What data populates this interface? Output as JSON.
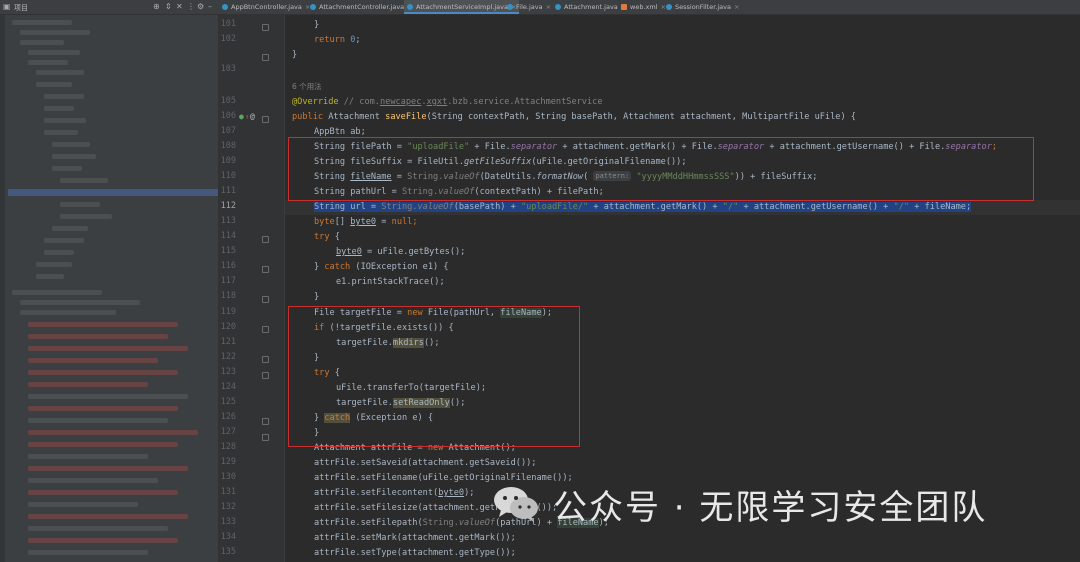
{
  "project_panel": {
    "title": "项目"
  },
  "tabs": [
    {
      "label": "AppBtnController.java",
      "active": false
    },
    {
      "label": "AttachmentController.java",
      "active": false
    },
    {
      "label": "AttachmentServiceImpl.java",
      "active": true
    },
    {
      "label": "File.java",
      "active": false
    },
    {
      "label": "Attachment.java",
      "active": false
    },
    {
      "label": "web.xml",
      "active": false
    },
    {
      "label": "SessionFilter.java",
      "active": false
    }
  ],
  "editor": {
    "usages_hint": "6 个用法",
    "current_line": "112",
    "line_numbers": [
      "101",
      "102",
      "103",
      "105",
      "106",
      "107",
      "108",
      "109",
      "110",
      "111",
      "112",
      "113",
      "114",
      "115",
      "116",
      "117",
      "118",
      "119",
      "120",
      "121",
      "122",
      "123",
      "124",
      "125",
      "126",
      "127",
      "128",
      "129",
      "130",
      "131",
      "132",
      "133",
      "134",
      "135"
    ],
    "code": {
      "l101": "}",
      "l102a": "return ",
      "l102b": "0",
      "l102c": ";",
      "l103": "}",
      "l105a": "@Override",
      "l105b": " // com.",
      "l105c": "newcapec",
      "l105d": ".",
      "l105e": "xgxt",
      "l105f": ".bzb.service.AttachmentService",
      "l106a": "public ",
      "l106b": "Attachment ",
      "l106c": "saveFile",
      "l106d": "(String contextPath, String basePath, Attachment attachment, MultipartFile uFile) {",
      "l107": "AppBtn ab;",
      "l108a": "String ",
      "l108b": "filePath",
      "l108c": " = ",
      "l108d": "\"uploadFile\"",
      "l108e": " + File.",
      "l108f": "separator",
      "l108g": " + attachment.getMark() + File.",
      "l108h": "separator",
      "l108i": " + attachment.getUsername() + File.",
      "l108j": "separator",
      "l108k": ";",
      "l109a": "String fileSuffix = FileUtil.",
      "l109b": "getFileSuffix",
      "l109c": "(uFile.getOriginalFilename());",
      "l110a": "String ",
      "l110b": "fileName",
      "l110c": " = ",
      "l110d": "String.",
      "l110e": "valueOf",
      "l110f": "(DateUtils.",
      "l110g": "formatNow",
      "l110h": "( ",
      "l110i": "pattern:",
      "l110j": " \"yyyyMMddHHmmssSSS\"",
      "l110k": ")) + fileSuffix;",
      "l111a": "String pathUrl = ",
      "l111b": "String.",
      "l111c": "valueOf",
      "l111d": "(contextPath) + filePath;",
      "l112a": "String url = ",
      "l112b": "String.",
      "l112c": "valueOf",
      "l112d": "(basePath) + ",
      "l112e": "\"uploadFile/\"",
      "l112f": " + attachment.getMark() + ",
      "l112g": "\"/\"",
      "l112h": " + attachment.getUsername() + ",
      "l112i": "\"/\"",
      "l112j": " + fileName;",
      "l113a": "byte",
      "l113b": "[] ",
      "l113c": "byte0",
      "l113d": " = ",
      "l113e": "null",
      "l113f": ";",
      "l114a": "try",
      "l114b": " {",
      "l115a": "byte0",
      "l115b": " = uFile.getBytes();",
      "l116a": "} ",
      "l116b": "catch",
      "l116c": " (IOException e1) {",
      "l117": "e1.printStackTrace();",
      "l118": "}",
      "l119a": "File targetFile = ",
      "l119b": "new ",
      "l119c": "File(pathUrl, ",
      "l119d": "fileName",
      "l119e": ");",
      "l120a": "if",
      "l120b": " (!targetFile.exists()) {",
      "l121a": "targetFile.",
      "l121b": "mkdirs",
      "l121c": "();",
      "l122": "}",
      "l123a": "try",
      "l123b": " {",
      "l124": "uFile.transferTo(targetFile);",
      "l125a": "targetFile.",
      "l125b": "setReadOnly",
      "l125c": "();",
      "l126a": "} ",
      "l126b": "catch",
      "l126c": " (Exception e) {",
      "l127": "}",
      "l128a": "Attachment attrFile = ",
      "l128b": "new ",
      "l128c": "Attachment();",
      "l129": "attrFile.setSaveid(attachment.getSaveid());",
      "l130": "attrFile.setFilename(uFile.getOriginalFilename());",
      "l131a": "attrFile.setFilecontent(",
      "l131b": "byte0",
      "l131c": ");",
      "l132": "attrFile.setFilesize(attachment.getFilesize());",
      "l133a": "attrFile.setFilepath(",
      "l133b": "String.",
      "l133c": "valueOf",
      "l133d": "(pathUrl) + ",
      "l133e": "fileName",
      "l133f": ");",
      "l134": "attrFile.setMark(attachment.getMark());",
      "l135": "attrFile.setType(attachment.getType());"
    }
  },
  "watermark": {
    "text": "公众号 · 无限学习安全团队",
    "icon": "wechat-icon"
  },
  "colors": {
    "keyword": "#cc7832",
    "string": "#6a8759",
    "number": "#6897bb",
    "static_field": "#9876aa",
    "method_decl": "#ffc66d",
    "annotation": "#bbb529",
    "red_box": "#c82f2f",
    "selection": "#214283"
  }
}
